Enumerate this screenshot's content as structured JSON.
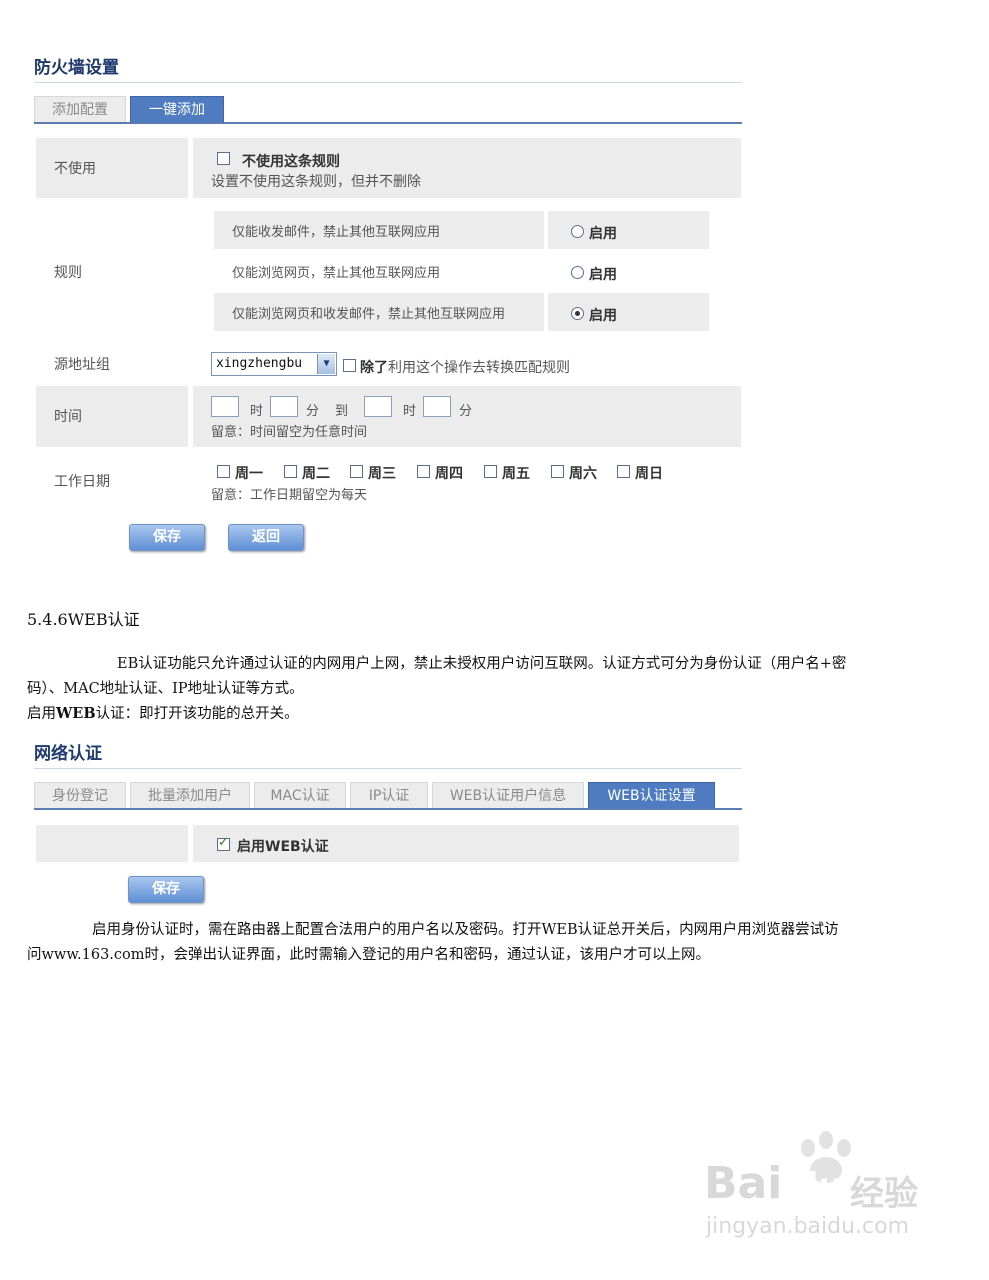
{
  "firewall": {
    "title": "防火墙设置",
    "tabs": [
      {
        "label": "添加配置",
        "active": false
      },
      {
        "label": "一键添加",
        "active": true
      }
    ],
    "disable": {
      "label": "不使用",
      "checkbox_label": "不使用这条规则",
      "hint": "设置不使用这条规则，但并不删除",
      "checked": false
    },
    "rules": {
      "label": "规则",
      "items": [
        {
          "text": "仅能收发邮件，禁止其他互联网应用",
          "radio_label": "启用",
          "selected": false
        },
        {
          "text": "仅能浏览网页，禁止其他互联网应用",
          "radio_label": "启用",
          "selected": false
        },
        {
          "text": "仅能浏览网页和收发邮件，禁止其他互联网应用",
          "radio_label": "启用",
          "selected": true
        }
      ]
    },
    "source": {
      "label": "源地址组",
      "select_value": "xingzhengbu",
      "except_bold": "除了",
      "except_rest": "利用这个操作去转换匹配规则",
      "except_checked": false
    },
    "time": {
      "label": "时间",
      "hour": "时",
      "minute": "分",
      "to": "到",
      "hint": "留意：时间留空为任意时间"
    },
    "workdays": {
      "label": "工作日期",
      "days": [
        "周一",
        "周二",
        "周三",
        "周四",
        "周五",
        "周六",
        "周日"
      ],
      "hint": "留意：工作日期留空为每天"
    },
    "buttons": {
      "save": "保存",
      "back": "返回"
    }
  },
  "doc": {
    "heading": "5.4.6WEB认证",
    "para1_line1": "EB认证功能只允许通过认证的内网用户上网，禁止未授权用户访问互联网。认证方式可分为身份认证（用户名+密",
    "para1_line2": "码）、MAC地址认证、IP地址认证等方式。",
    "para2_pre": "启用",
    "para2_bold": "WEB",
    "para2_post": "认证：即打开该功能的总开关。",
    "para3_line1": "启用身份认证时，需在路由器上配置合法用户的用户名以及密码。打开WEB认证总开关后，内网用户用浏览器尝试访",
    "para3_line2": "问www.163.com时，会弹出认证界面，此时需输入登记的用户名和密码，通过认证，该用户才可以上网。"
  },
  "netauth": {
    "title": "网络认证",
    "tabs": [
      {
        "label": "身份登记",
        "active": false
      },
      {
        "label": "批量添加用户",
        "active": false
      },
      {
        "label": "MAC认证",
        "active": false
      },
      {
        "label": "IP认证",
        "active": false
      },
      {
        "label": "WEB认证用户信息",
        "active": false
      },
      {
        "label": "WEB认证设置",
        "active": true
      }
    ],
    "enable_label": "启用WEB认证",
    "enable_checked": true,
    "save": "保存"
  },
  "watermark": {
    "brand": "Bai",
    "brand2": "du",
    "brand_cn": "经验",
    "url": "jingyan.baidu.com"
  }
}
